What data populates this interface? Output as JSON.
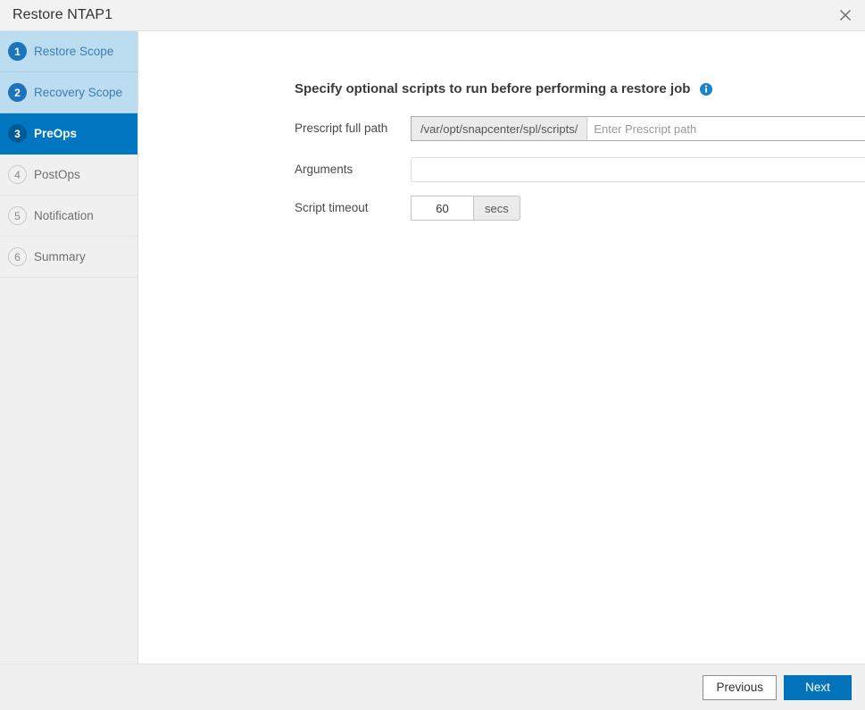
{
  "window": {
    "title": "Restore NTAP1",
    "close_icon": "close-icon"
  },
  "sidebar": {
    "steps": [
      {
        "number": "1",
        "label": "Restore Scope",
        "state": "visited"
      },
      {
        "number": "2",
        "label": "Recovery Scope",
        "state": "visited"
      },
      {
        "number": "3",
        "label": "PreOps",
        "state": "active"
      },
      {
        "number": "4",
        "label": "PostOps",
        "state": "pending"
      },
      {
        "number": "5",
        "label": "Notification",
        "state": "pending"
      },
      {
        "number": "6",
        "label": "Summary",
        "state": "pending"
      }
    ]
  },
  "main": {
    "heading": "Specify optional scripts to run before performing a restore job",
    "info_icon": "info-icon",
    "fields": {
      "prescript": {
        "label": "Prescript full path",
        "prefix": "/var/opt/snapcenter/spl/scripts/",
        "value": "",
        "placeholder": "Enter Prescript path"
      },
      "arguments": {
        "label": "Arguments",
        "value": "",
        "placeholder": ""
      },
      "script_timeout": {
        "label": "Script timeout",
        "value": "60",
        "unit": "secs"
      }
    }
  },
  "footer": {
    "previous_label": "Previous",
    "next_label": "Next"
  },
  "colors": {
    "accent_blue": "#0272bb",
    "active_step_bg": "#0077c0",
    "visited_step_bg": "#bcdcf0",
    "pending_step_bg": "#f0f0f0",
    "titlebar_bg": "#f2f2f2",
    "footer_bg": "#f0f0f0"
  }
}
